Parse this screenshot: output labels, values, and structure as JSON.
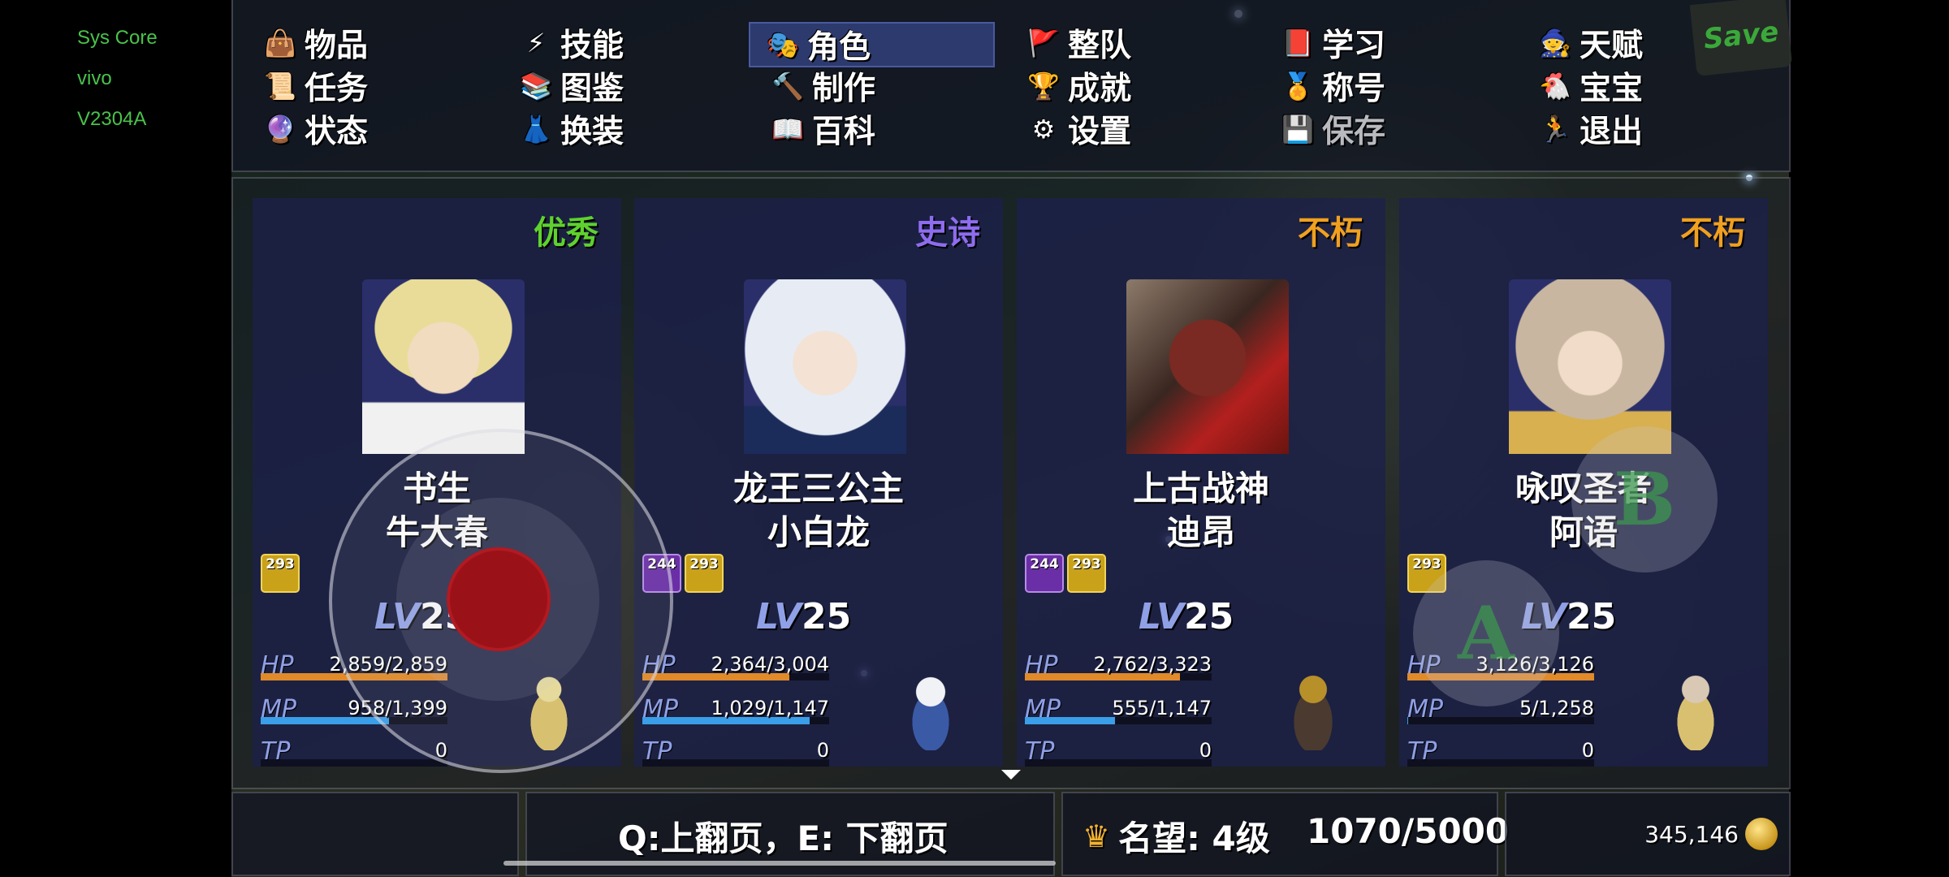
{
  "system_overlay": [
    "Sys Core",
    "vivo",
    "V2304A"
  ],
  "menu": {
    "items": [
      {
        "label": "物品",
        "icon": "bag-icon",
        "emoji": "👜"
      },
      {
        "label": "技能",
        "icon": "skill-icon",
        "emoji": "⚡"
      },
      {
        "label": "角色",
        "icon": "mask-icon",
        "emoji": "🎭"
      },
      {
        "label": "整队",
        "icon": "flag-icon",
        "emoji": "🚩"
      },
      {
        "label": "学习",
        "icon": "book-icon",
        "emoji": "📕"
      },
      {
        "label": "天赋",
        "icon": "talent-icon",
        "emoji": "🧙"
      },
      {
        "label": "任务",
        "icon": "scroll-icon",
        "emoji": "📜"
      },
      {
        "label": "图鉴",
        "icon": "atlas-icon",
        "emoji": "📚"
      },
      {
        "label": "制作",
        "icon": "anvil-icon",
        "emoji": "🔨"
      },
      {
        "label": "成就",
        "icon": "trophy-icon",
        "emoji": "🏆"
      },
      {
        "label": "称号",
        "icon": "medal-icon",
        "emoji": "🏅"
      },
      {
        "label": "宝宝",
        "icon": "pet-icon",
        "emoji": "🐔"
      },
      {
        "label": "状态",
        "icon": "status-icon",
        "emoji": "🔮"
      },
      {
        "label": "换装",
        "icon": "outfit-icon",
        "emoji": "👗"
      },
      {
        "label": "百科",
        "icon": "encyclopedia-icon",
        "emoji": "📖"
      },
      {
        "label": "设置",
        "icon": "gear-icon",
        "emoji": "⚙"
      },
      {
        "label": "保存",
        "icon": "floppy-icon",
        "emoji": "💾"
      },
      {
        "label": "退出",
        "icon": "exit-icon",
        "emoji": "🏃"
      }
    ],
    "active": "角色",
    "disabled": "保存",
    "save_button": "Save"
  },
  "party": [
    {
      "rarity": "优秀",
      "rarity_color": "#5fd12f",
      "title": "书生",
      "name": "牛大春",
      "badges": [
        "293"
      ],
      "level_label": "LV",
      "level": "25",
      "hp": "2,859/2,859",
      "hp_fill": 1.0,
      "mp": "958/1,399",
      "mp_fill": 0.685,
      "tp": "0",
      "tp_fill": 0
    },
    {
      "rarity": "史诗",
      "rarity_color": "#8e6cf0",
      "title": "龙王三公主",
      "name": "小白龙",
      "badges": [
        "244",
        "293"
      ],
      "level_label": "LV",
      "level": "25",
      "hp": "2,364/3,004",
      "hp_fill": 0.787,
      "mp": "1,029/1,147",
      "mp_fill": 0.897,
      "tp": "0",
      "tp_fill": 0
    },
    {
      "rarity": "不朽",
      "rarity_color": "#f0a020",
      "title": "上古战神",
      "name": "迪昂",
      "badges": [
        "244",
        "293"
      ],
      "level_label": "LV",
      "level": "25",
      "hp": "2,762/3,323",
      "hp_fill": 0.831,
      "mp": "555/1,147",
      "mp_fill": 0.484,
      "tp": "0",
      "tp_fill": 0
    },
    {
      "rarity": "不朽",
      "rarity_color": "#f0a020",
      "title": "咏叹圣者",
      "name": "阿语",
      "badges": [
        "293"
      ],
      "level_label": "LV",
      "level": "25",
      "hp": "3,126/3,126",
      "hp_fill": 1.0,
      "mp": "5/1,258",
      "mp_fill": 0.004,
      "tp": "0",
      "tp_fill": 0
    }
  ],
  "stat_labels": {
    "hp": "HP",
    "mp": "MP",
    "tp": "TP"
  },
  "colors": {
    "hp": "#e08a2a",
    "mp": "#3a9ee8",
    "tp": "#5a5a8a",
    "stat_label": "#8fa0e6"
  },
  "bottom": {
    "page_hint": "Q:上翻页，E: 下翻页",
    "reputation": "名望: 4级",
    "reputation_progress": "1070/5000",
    "gold": "345,146"
  },
  "controls": {
    "button_a": "A",
    "button_b": "B"
  }
}
